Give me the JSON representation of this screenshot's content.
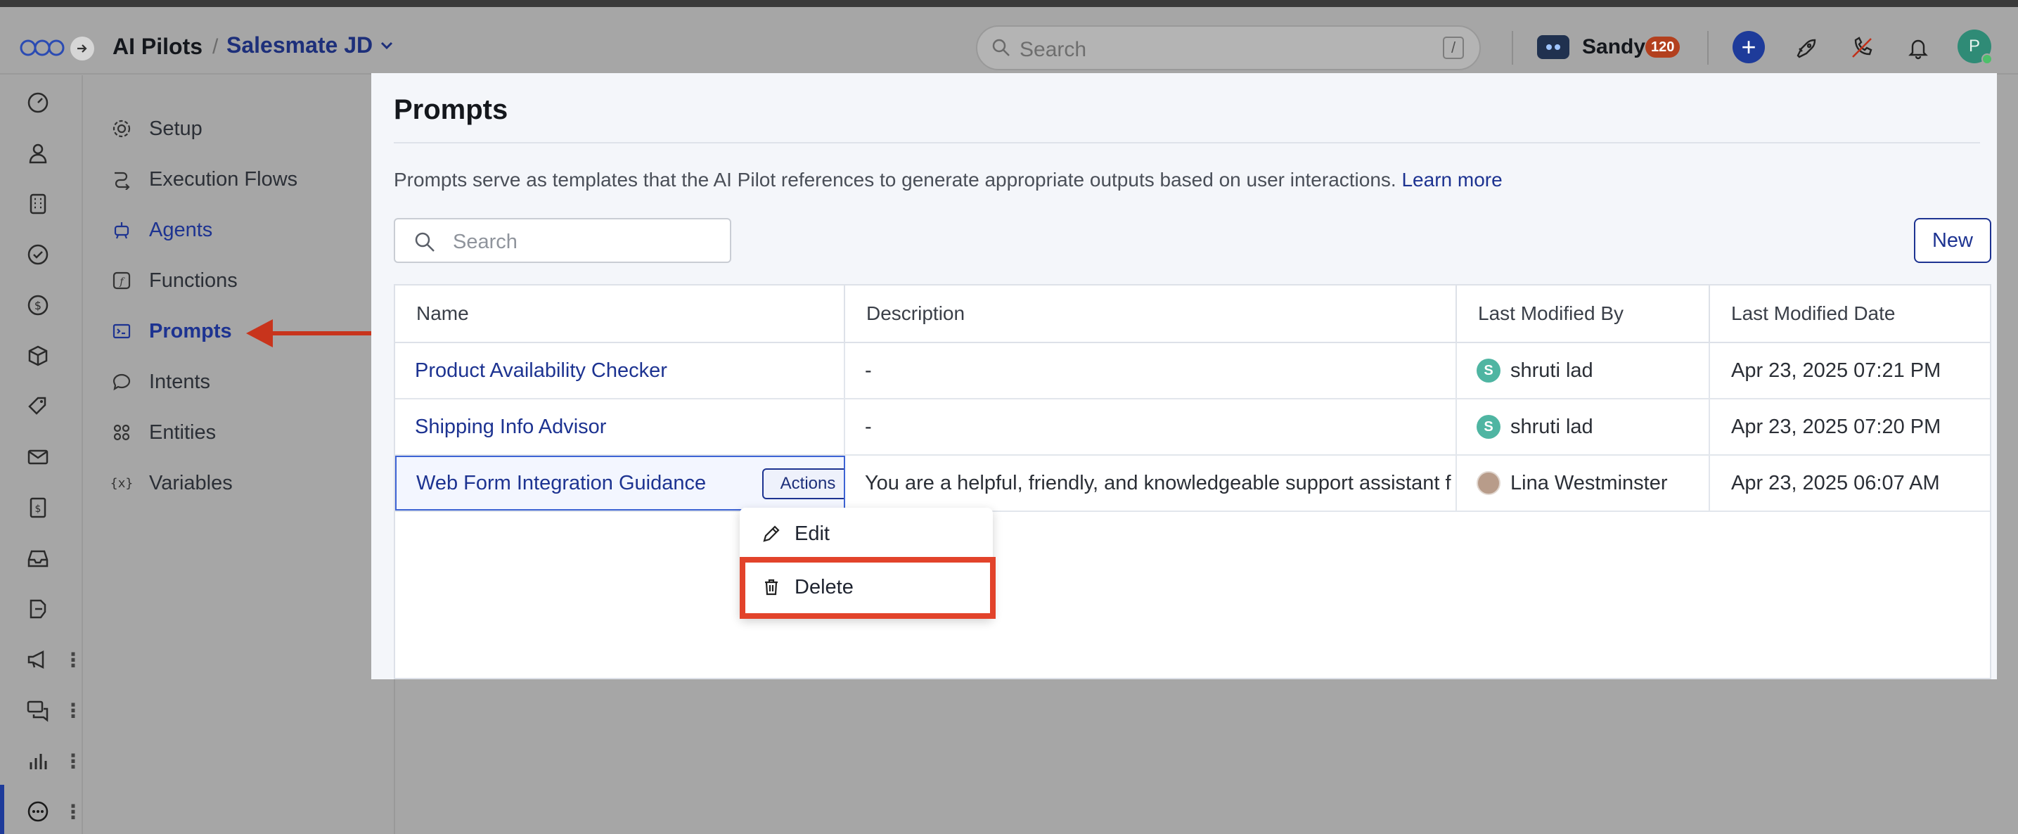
{
  "header": {
    "app_title": "AI Pilots",
    "workspace": "Salesmate JD",
    "search_placeholder": "Search",
    "search_shortcut": "/",
    "user_name": "Sandy",
    "user_badge": "120",
    "avatar_initial": "P"
  },
  "nav": {
    "items": [
      {
        "label": "Setup",
        "icon": "gear-icon"
      },
      {
        "label": "Execution Flows",
        "icon": "flow-icon"
      },
      {
        "label": "Agents",
        "icon": "agent-icon"
      },
      {
        "label": "Functions",
        "icon": "function-icon"
      },
      {
        "label": "Prompts",
        "icon": "terminal-icon"
      },
      {
        "label": "Intents",
        "icon": "chat-bubble-icon"
      },
      {
        "label": "Entities",
        "icon": "entities-icon"
      },
      {
        "label": "Variables",
        "icon": "variable-braces-icon"
      }
    ],
    "active": "Prompts"
  },
  "panel": {
    "title": "Prompts",
    "description": "Prompts serve as templates that the AI Pilot references to generate appropriate outputs based on user interactions.",
    "learn_more": "Learn more",
    "search_placeholder": "Search",
    "new_label": "New"
  },
  "table": {
    "columns": [
      "Name",
      "Description",
      "Last Modified By",
      "Last Modified Date"
    ],
    "rows": [
      {
        "name": "Product Availability Checker",
        "description": "-",
        "modified_by": "shruti lad",
        "initial": "S",
        "date": "Apr 23, 2025 07:21 PM"
      },
      {
        "name": "Shipping Info Advisor",
        "description": "-",
        "modified_by": "shruti lad",
        "initial": "S",
        "date": "Apr 23, 2025 07:20 PM"
      },
      {
        "name": "Web Form Integration Guidance",
        "description": "You are a helpful, friendly, and knowledgeable support assistant f",
        "modified_by": "Lina Westminster",
        "initial": "",
        "date": "Apr 23, 2025 06:07 AM"
      }
    ],
    "actions_label": "Actions"
  },
  "menu": {
    "edit_label": "Edit",
    "delete_label": "Delete"
  },
  "colors": {
    "accent": "#1d3391",
    "highlight": "#e2432b",
    "badge": "#b3401e"
  }
}
